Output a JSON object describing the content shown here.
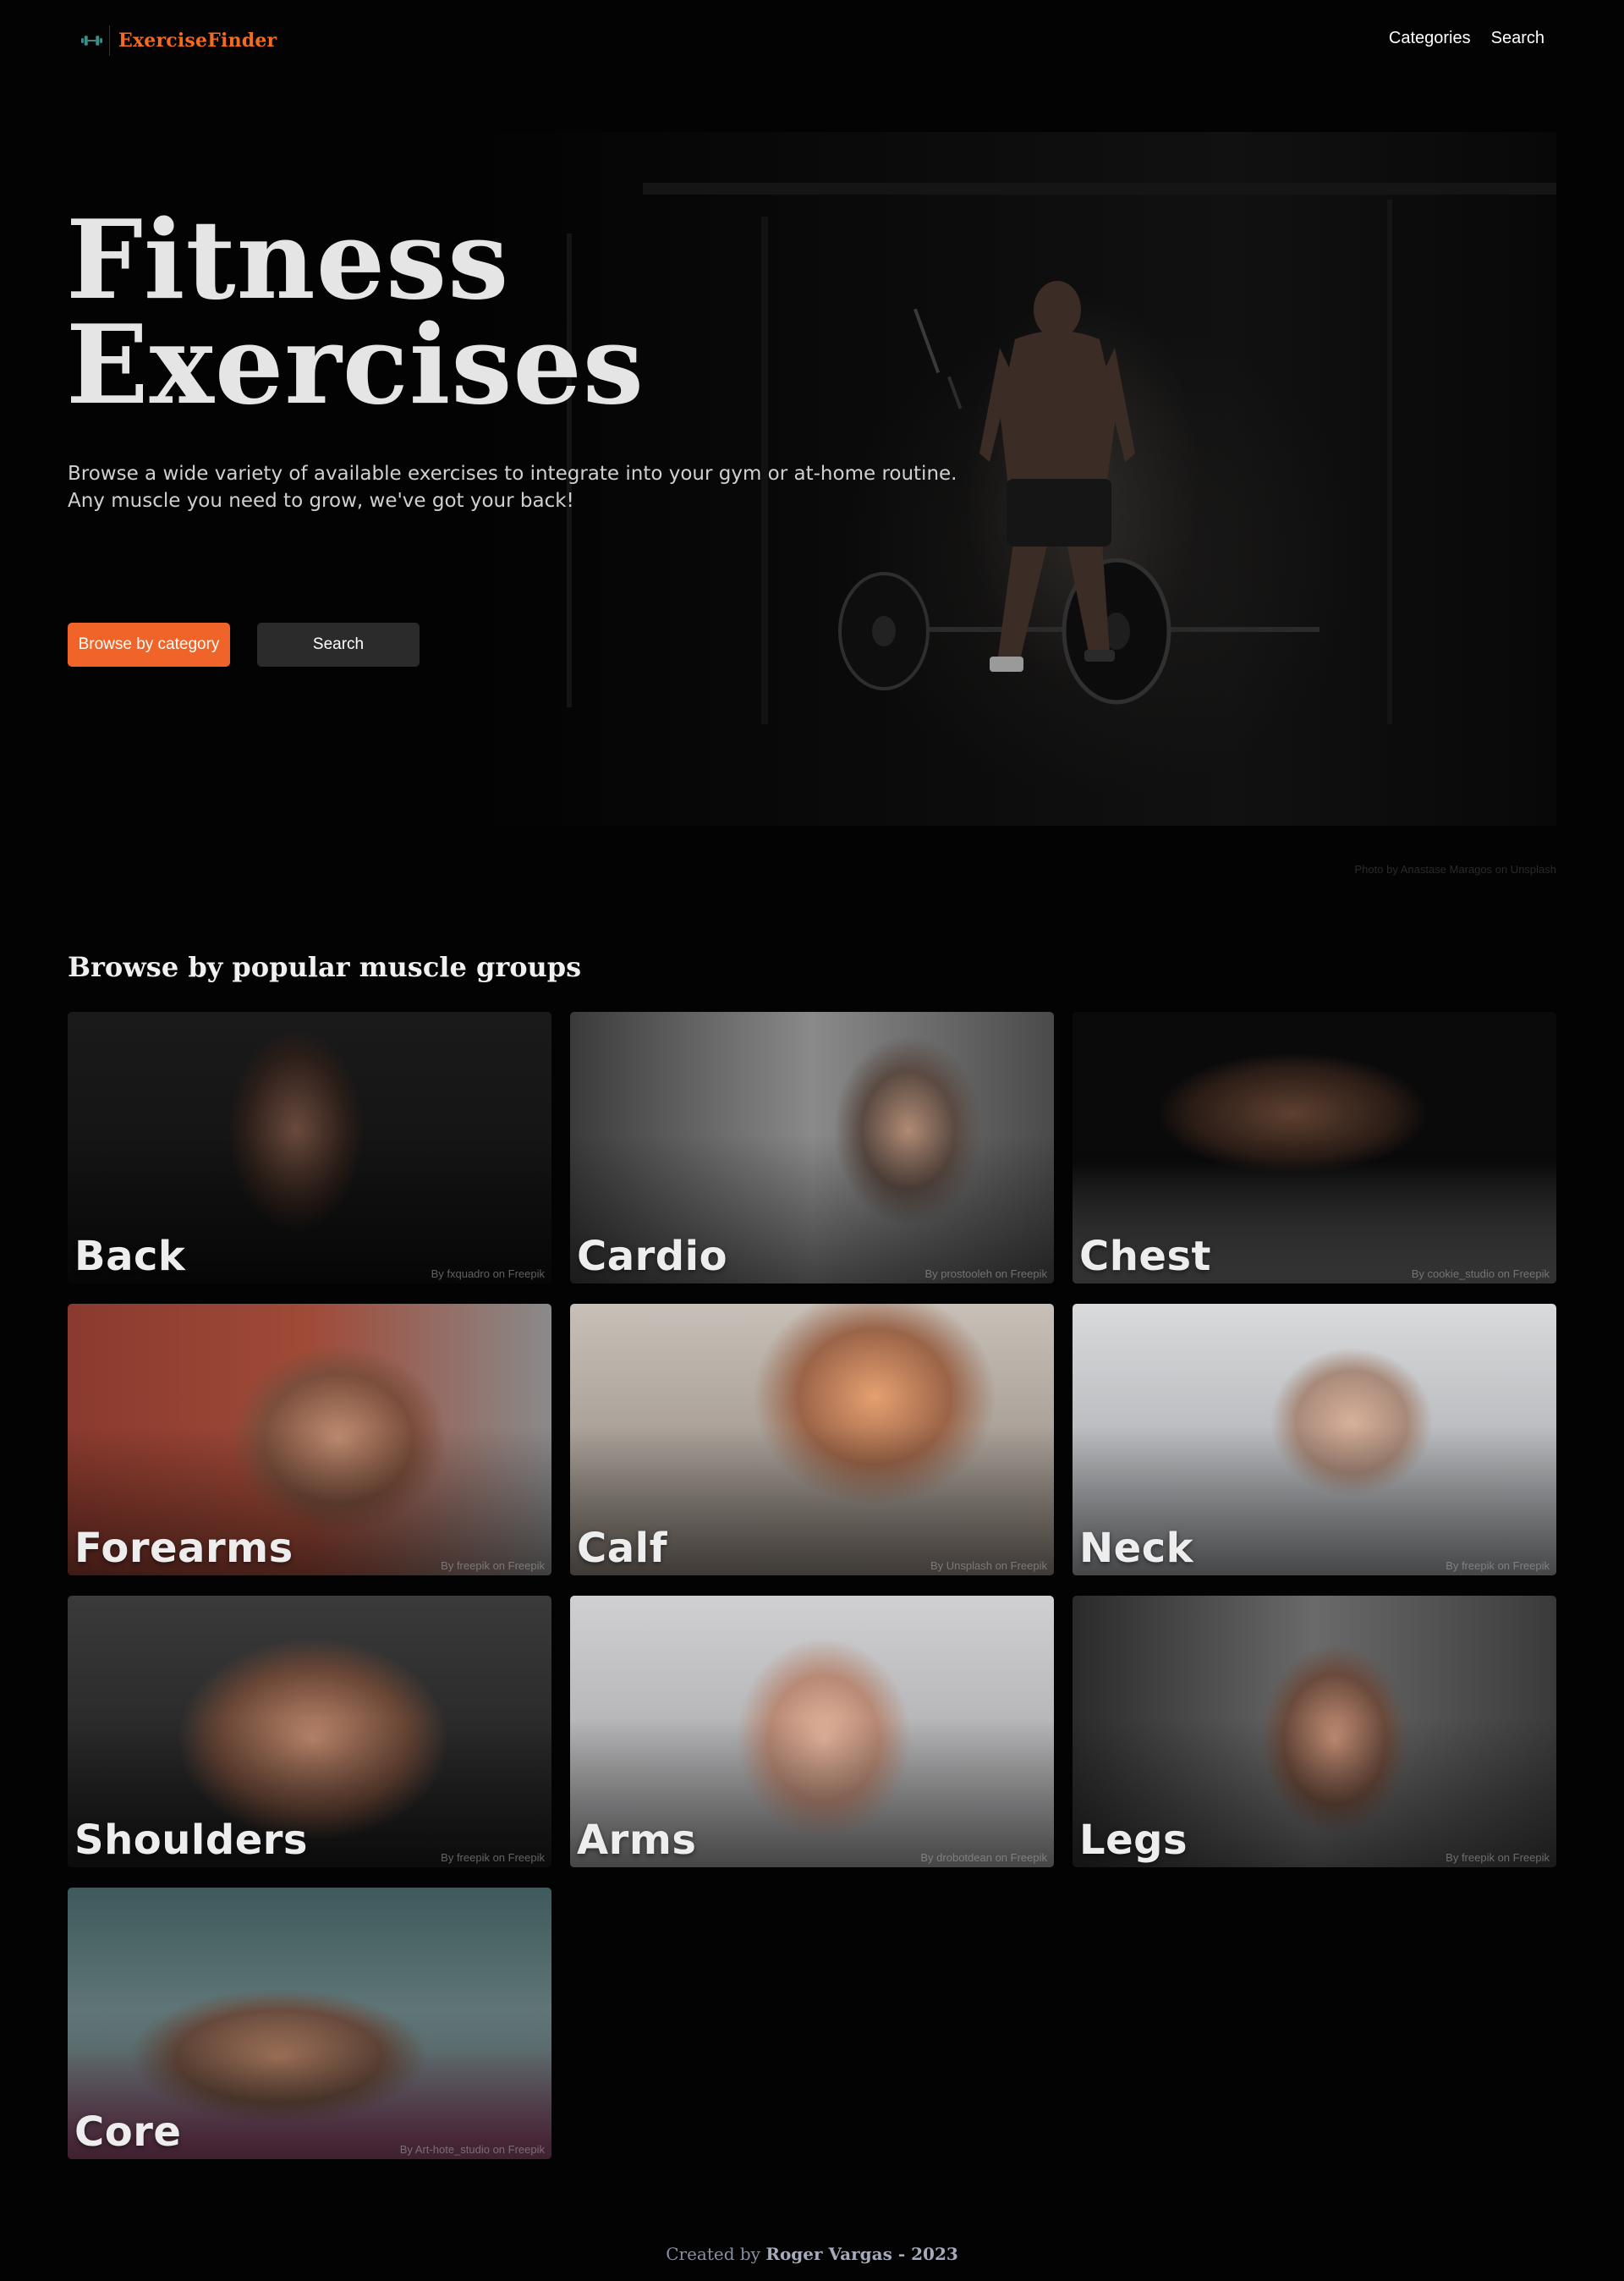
{
  "nav": {
    "brand": "ExerciseFinder",
    "links": [
      "Categories",
      "Search"
    ]
  },
  "hero": {
    "title_line1": "Fitness",
    "title_line2": "Exercises",
    "desc_line1": "Browse a wide variety of available exercises to integrate into your gym or at-home routine.",
    "desc_line2": "Any muscle you need to grow, we've got your back!",
    "btn_primary": "Browse by category",
    "btn_secondary": "Search",
    "photo_credit": "Photo by Anastase Maragos on Unsplash"
  },
  "muscles": {
    "title": "Browse by popular muscle groups",
    "cards": [
      {
        "name": "Back",
        "credit": "By fxquadro on Freepik"
      },
      {
        "name": "Cardio",
        "credit": "By prostooleh on Freepik"
      },
      {
        "name": "Chest",
        "credit": "By cookie_studio on Freepik"
      },
      {
        "name": "Forearms",
        "credit": "By freepik on Freepik"
      },
      {
        "name": "Calf",
        "credit": "By Unsplash on Freepik"
      },
      {
        "name": "Neck",
        "credit": "By freepik on Freepik"
      },
      {
        "name": "Shoulders",
        "credit": "By freepik on Freepik"
      },
      {
        "name": "Arms",
        "credit": "By drobotdean on Freepik"
      },
      {
        "name": "Legs",
        "credit": "By freepik on Freepik"
      },
      {
        "name": "Core",
        "credit": "By Art-hote_studio on Freepik"
      }
    ]
  },
  "footer": {
    "prefix": "Created by",
    "author": "Roger Vargas - 2023"
  },
  "colors": {
    "accent": "#f0642a",
    "background": "#030303",
    "secondary_button": "#2b2b2b"
  }
}
